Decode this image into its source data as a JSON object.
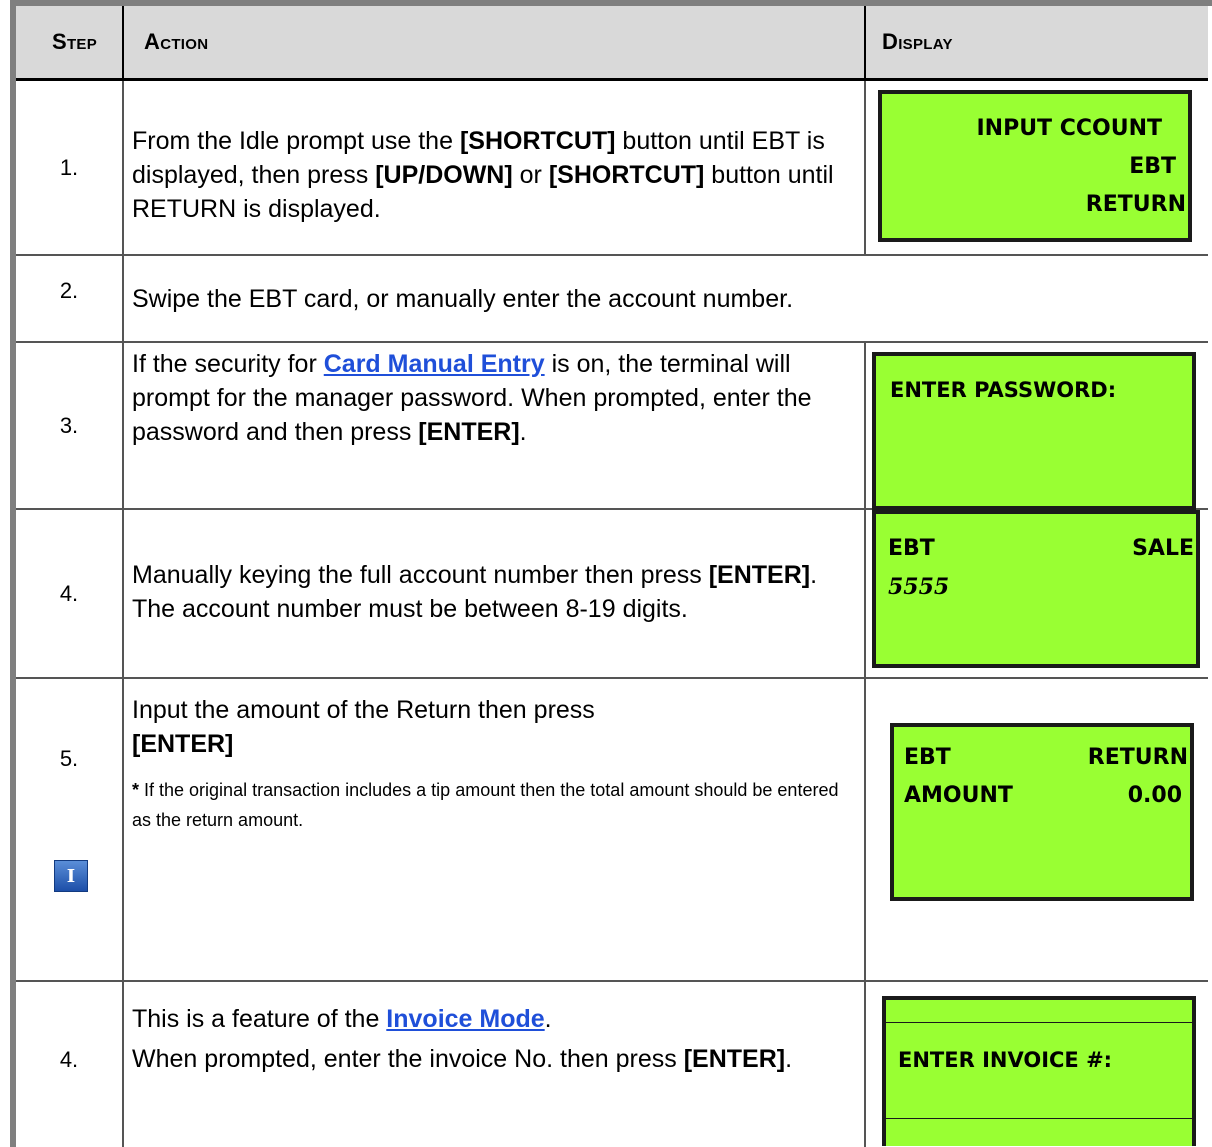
{
  "header": {
    "step": "Step",
    "action": "Action",
    "display": "Display"
  },
  "rows": [
    {
      "step": "1.",
      "action_parts": [
        "From the Idle prompt use the ",
        "[SHORTCUT]",
        " button until EBT is displayed, then press ",
        "[UP/DOWN]",
        " or ",
        "[SHORTCUT]",
        " button until RETURN is displayed."
      ],
      "display_lines": [
        "INPUT CCOUNT",
        "EBT",
        "RETURN"
      ]
    },
    {
      "step": "2.",
      "action": "Swipe the EBT card, or manually enter the account number."
    },
    {
      "step": "3.",
      "action_pre": "If the security for ",
      "action_link": "Card Manual Entry",
      "action_post": " is on, the terminal will prompt for the manager password. When prompted, enter the password and then press ",
      "action_bold": "[ENTER]",
      "action_end": ".",
      "display_lines": [
        "ENTER PASSWORD:"
      ]
    },
    {
      "step": "4.",
      "action_pre": "Manually keying the full account number then press ",
      "action_bold": "[ENTER]",
      "action_post": ". The account number must be between 8-19 digits.",
      "display_left": "EBT",
      "display_right": "SALE",
      "display_line2": "5555"
    },
    {
      "step": "5.",
      "action_line1": "Input the amount of the Return then press",
      "action_bold": "[ENTER]",
      "note_star": "*",
      "note": " If the original transaction includes a tip amount then the total amount should be entered as the return amount.",
      "icon_letter": "I",
      "display_l1_left": "EBT",
      "display_l1_right": "RETURN",
      "display_l2_left": "AMOUNT",
      "display_l2_right": "0.00"
    },
    {
      "step": "4.",
      "action_pre": "This is a feature of the ",
      "action_link": "Invoice Mode",
      "action_post": ".",
      "action_line2": "When prompted, enter the invoice No. then press ",
      "action_bold": "[ENTER]",
      "action_end": ".",
      "display_line": "ENTER INVOICE #:"
    }
  ],
  "colors": {
    "lcd_green": "#99ff33",
    "header_gray": "#d9d9d9",
    "link_blue": "#1f4fd9"
  }
}
